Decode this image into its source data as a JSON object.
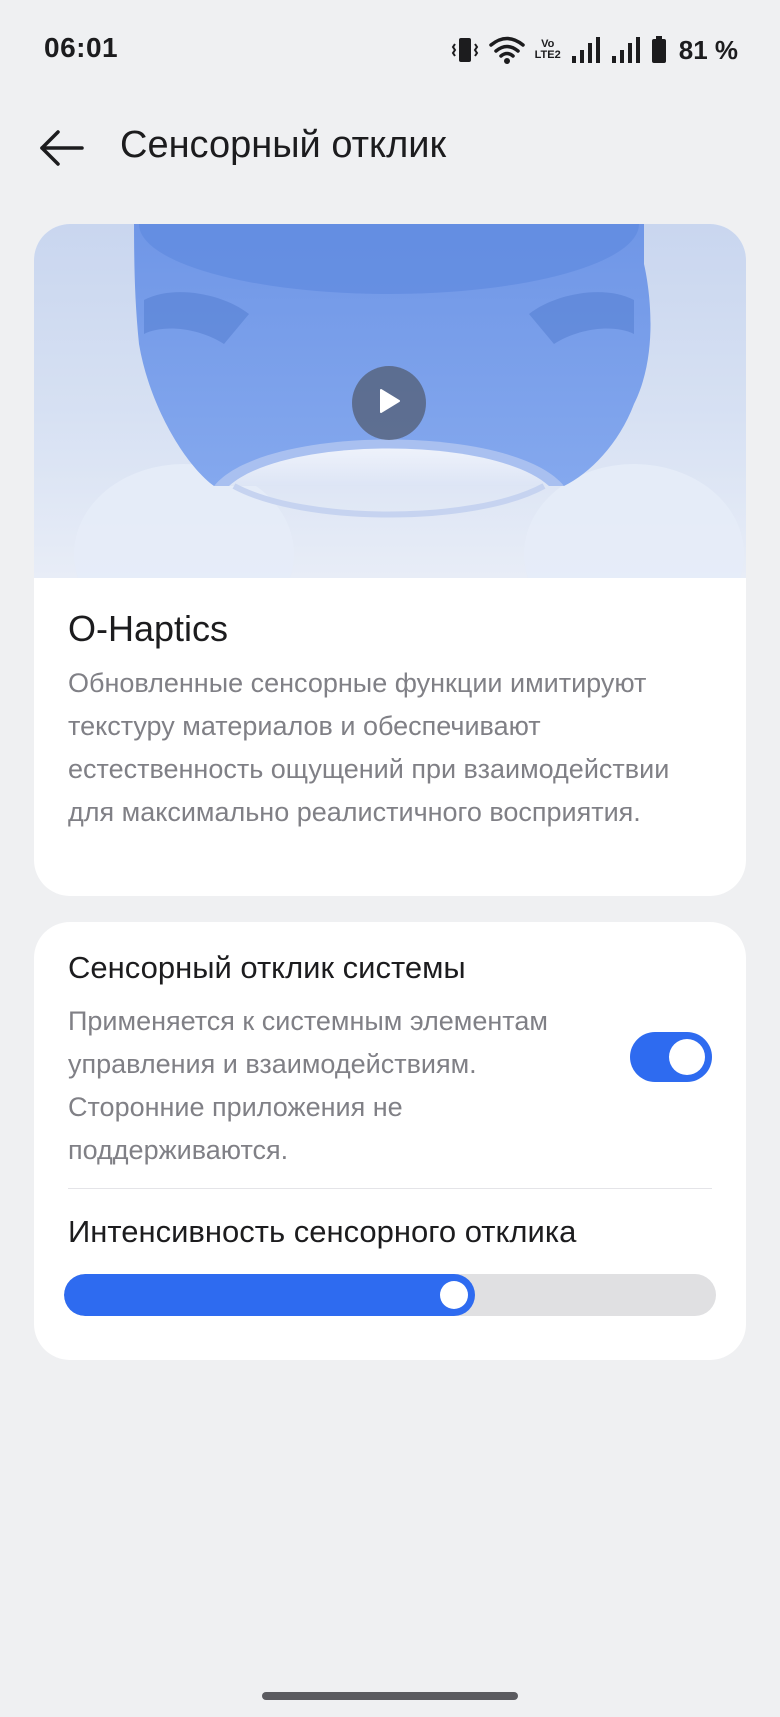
{
  "status_bar": {
    "time": "06:01",
    "volte_top": "Vo",
    "volte_bottom": "LTE2",
    "battery": "81 %"
  },
  "header": {
    "title": "Сенсорный отклик",
    "back_icon": "arrow-left-icon"
  },
  "intro": {
    "title": "O-Haptics",
    "description": "Обновленные сенсорные функции имитируют текстуру материалов и обеспечивают естественность ощущений при взаимодействии для максимально реалистичного восприятия.",
    "play_icon": "play-icon"
  },
  "settings": {
    "system_haptics_title": "Сенсорный отклик системы",
    "system_haptics_desc": "Применяется к системным элементам управления и взаимодействиям. Сторонние приложения не поддерживаются.",
    "system_haptics_enabled": true,
    "intensity_title": "Интенсивность сенсорного отклика",
    "intensity_level": 0.63
  },
  "colors": {
    "accent": "#2e6bf0",
    "background": "#eff0f2",
    "card": "#ffffff",
    "secondary_text": "#808086"
  }
}
